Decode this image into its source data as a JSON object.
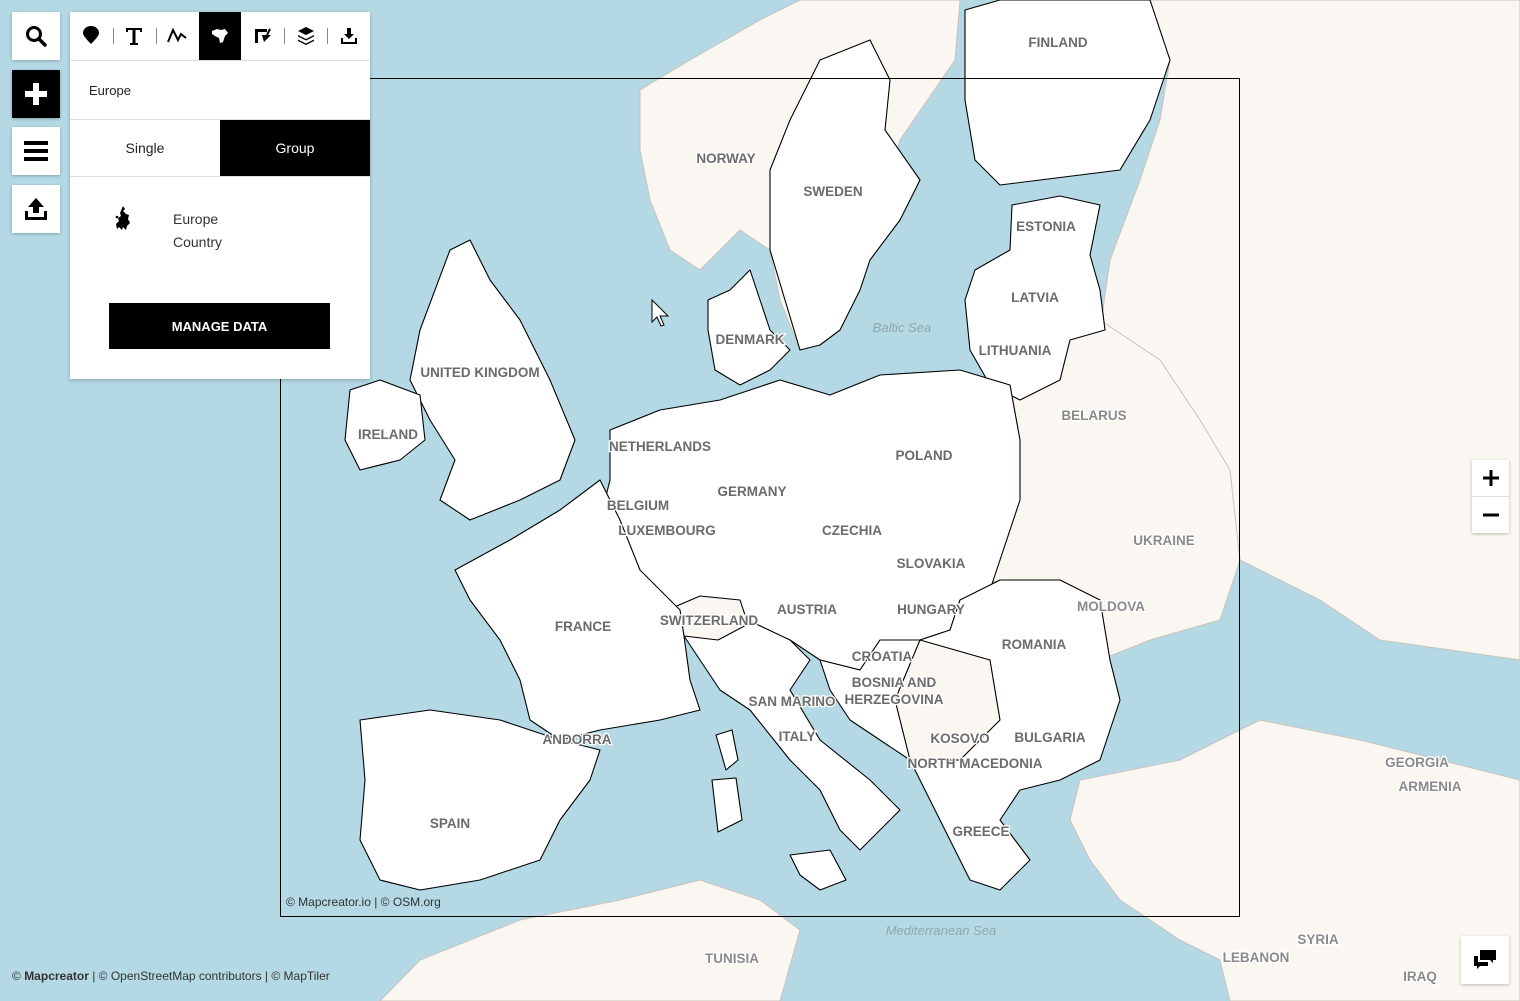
{
  "toolbar": {
    "tools": [
      {
        "icon": "marker-icon"
      },
      {
        "icon": "text-icon",
        "label": "T"
      },
      {
        "icon": "line-icon"
      },
      {
        "icon": "country-icon",
        "active": true
      },
      {
        "icon": "area-icon"
      },
      {
        "icon": "layers-icon"
      },
      {
        "icon": "download-icon"
      }
    ]
  },
  "side_buttons": [
    "search-icon",
    "add-icon",
    "menu-icon",
    "upload-icon"
  ],
  "panel": {
    "name_value": "Europe",
    "mode_single": "Single",
    "mode_group": "Group",
    "active_mode": "Group",
    "layer_title": "Europe",
    "layer_subtitle": "Country",
    "manage_label": "MANAGE DATA"
  },
  "map": {
    "countries_selected": [
      "FINLAND",
      "NORWAY",
      "SWEDEN",
      "ESTONIA",
      "LATVIA",
      "LITHUANIA",
      "DENMARK",
      "UNITED KINGDOM",
      "IRELAND",
      "NETHERLANDS",
      "BELGIUM",
      "LUXEMBOURG",
      "GERMANY",
      "POLAND",
      "CZECHIA",
      "SLOVAKIA",
      "AUSTRIA",
      "HUNGARY",
      "ROMANIA",
      "FRANCE",
      "SWITZERLAND",
      "CROATIA",
      "BOSNIA AND",
      "HERZEGOVINA",
      "SAN MARINO",
      "ITALY",
      "KOSOVO",
      "BULGARIA",
      "NORTH MACEDONIA",
      "GREECE",
      "ANDORRA",
      "SPAIN"
    ],
    "countries_other": [
      "BELARUS",
      "UKRAINE",
      "MOLDOVA",
      "GEORGIA",
      "ARMENIA",
      "TUNISIA",
      "LEBANON",
      "SYRIA",
      "IRAQ"
    ],
    "seas": [
      "Baltic Sea",
      "Mediterranean Sea"
    ],
    "colors": {
      "water": "#b4d9e4",
      "land": "#faf6f1",
      "selected": "#ffffff",
      "border": "#000000"
    }
  },
  "attribution": {
    "inner": "© Mapcreator.io | © OSM.org",
    "outer_brand": "Mapcreator",
    "outer_prefix": "© ",
    "outer_rest": " | © OpenStreetMap contributors | © MapTiler"
  },
  "zoom": {
    "in": "+",
    "out": "−"
  }
}
